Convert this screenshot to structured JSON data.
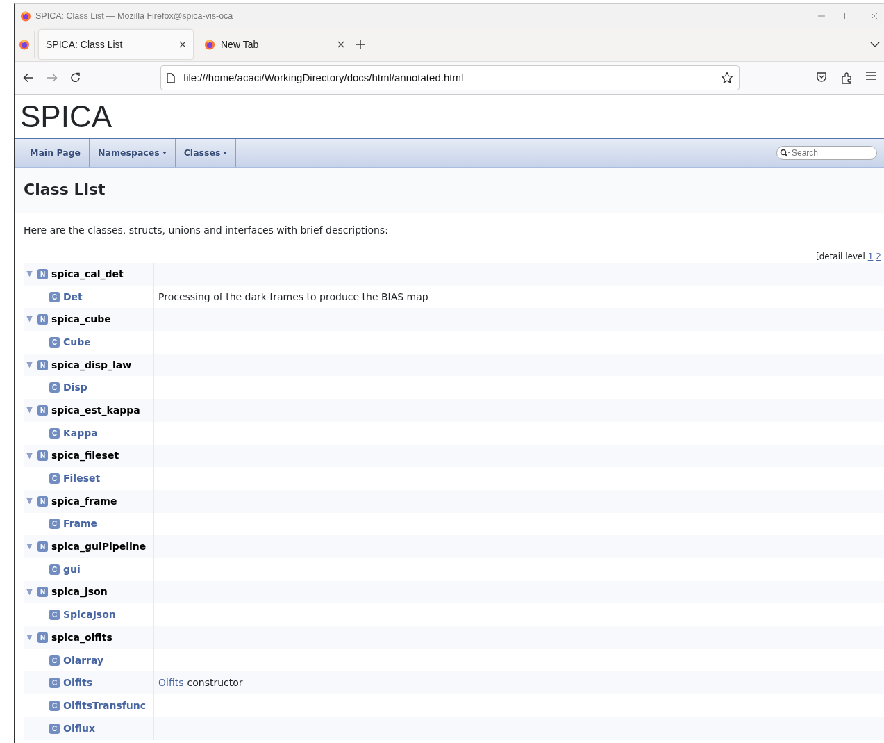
{
  "window": {
    "title": "SPICA: Class List — Mozilla Firefox@spica-vis-oca"
  },
  "tabs": [
    {
      "label": "SPICA: Class List",
      "selected": true
    },
    {
      "label": "New Tab",
      "selected": false
    }
  ],
  "address_bar": {
    "value": "file:///home/acaci/WorkingDirectory/docs/html/annotated.html"
  },
  "project_title": "SPICA",
  "nav": [
    {
      "label": "Main Page",
      "dropdown": false
    },
    {
      "label": "Namespaces",
      "dropdown": true
    },
    {
      "label": "Classes",
      "dropdown": true
    }
  ],
  "search": {
    "placeholder": "Search"
  },
  "heading": "Class List",
  "intro": "Here are the classes, structs, unions and interfaces with brief descriptions:",
  "detail_level": {
    "label": "[detail level",
    "levels": [
      "1",
      "2"
    ]
  },
  "tree": [
    {
      "toggle": "▼",
      "expanded": true,
      "badge": "N",
      "name": "spica_cal_det",
      "children": [
        {
          "badge": "C",
          "name": "Det",
          "description": "Processing of the dark frames to produce the BIAS map"
        }
      ]
    },
    {
      "toggle": "▼",
      "expanded": true,
      "badge": "N",
      "name": "spica_cube",
      "children": [
        {
          "badge": "C",
          "name": "Cube"
        }
      ]
    },
    {
      "toggle": "▼",
      "expanded": true,
      "badge": "N",
      "name": "spica_disp_law",
      "children": [
        {
          "badge": "C",
          "name": "Disp"
        }
      ]
    },
    {
      "toggle": "▼",
      "expanded": true,
      "badge": "N",
      "name": "spica_est_kappa",
      "children": [
        {
          "badge": "C",
          "name": "Kappa"
        }
      ]
    },
    {
      "toggle": "▼",
      "expanded": true,
      "badge": "N",
      "name": "spica_fileset",
      "children": [
        {
          "badge": "C",
          "name": "Fileset"
        }
      ]
    },
    {
      "toggle": "▼",
      "expanded": true,
      "badge": "N",
      "name": "spica_frame",
      "children": [
        {
          "badge": "C",
          "name": "Frame"
        }
      ]
    },
    {
      "toggle": "▼",
      "expanded": true,
      "badge": "N",
      "name": "spica_guiPipeline",
      "children": [
        {
          "badge": "C",
          "name": "gui"
        }
      ]
    },
    {
      "toggle": "▼",
      "expanded": true,
      "badge": "N",
      "name": "spica_json",
      "children": [
        {
          "badge": "C",
          "name": "SpicaJson"
        }
      ]
    },
    {
      "toggle": "▼",
      "expanded": true,
      "badge": "N",
      "name": "spica_oifits",
      "children": [
        {
          "badge": "C",
          "name": "Oiarray"
        },
        {
          "badge": "C",
          "name": "Oifits",
          "description_link": "Oifits",
          "description": "constructor"
        },
        {
          "badge": "C",
          "name": "OifitsTransfunc"
        },
        {
          "badge": "C",
          "name": "Oiflux"
        }
      ]
    }
  ]
}
